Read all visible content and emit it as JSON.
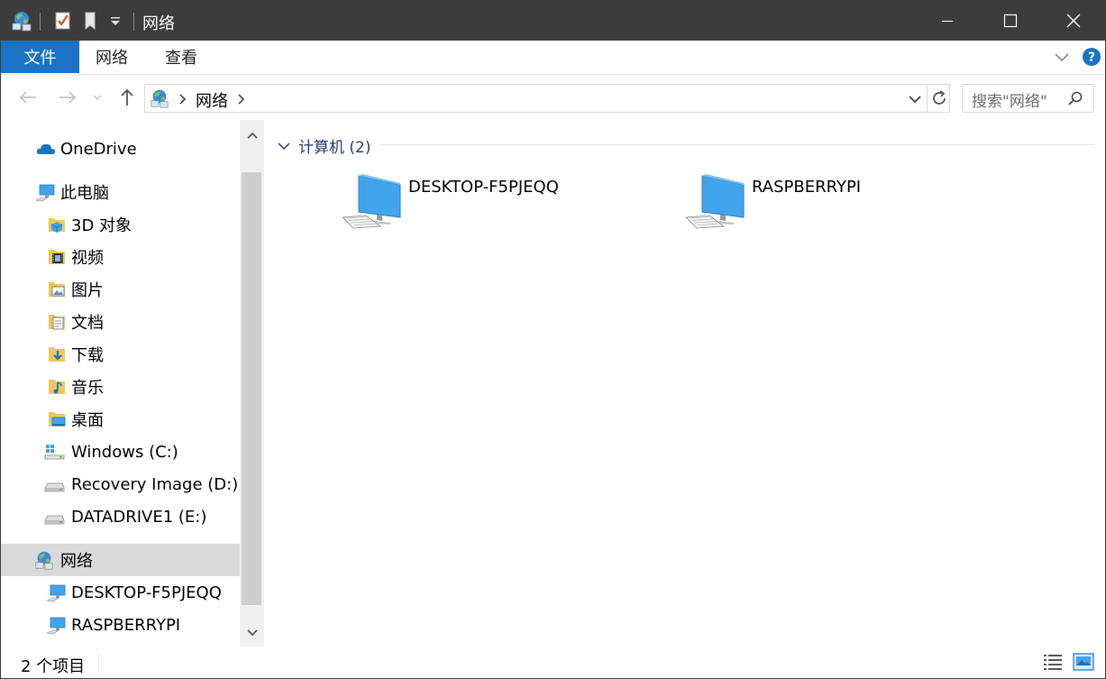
{
  "window": {
    "title": "网络",
    "minimize_icon": "minimize-icon",
    "maximize_icon": "maximize-icon",
    "close_icon": "close-icon"
  },
  "ribbon": {
    "tabs": [
      {
        "label": "文件",
        "active": true
      },
      {
        "label": "网络",
        "active": false
      },
      {
        "label": "查看",
        "active": false
      }
    ]
  },
  "address_bar": {
    "location": "网络",
    "search_placeholder": "搜索\"网络\""
  },
  "sidebar": {
    "items": [
      {
        "label": "OneDrive",
        "icon": "cloud-icon"
      },
      {
        "label": "此电脑",
        "icon": "computer-icon"
      },
      {
        "label": "3D 对象",
        "icon": "3d-objects-icon"
      },
      {
        "label": "视频",
        "icon": "videos-icon"
      },
      {
        "label": "图片",
        "icon": "pictures-icon"
      },
      {
        "label": "文档",
        "icon": "documents-icon"
      },
      {
        "label": "下载",
        "icon": "downloads-icon"
      },
      {
        "label": "音乐",
        "icon": "music-icon"
      },
      {
        "label": "桌面",
        "icon": "desktop-icon"
      },
      {
        "label": "Windows (C:)",
        "icon": "windows-drive-icon"
      },
      {
        "label": "Recovery Image (D:)",
        "icon": "drive-icon"
      },
      {
        "label": "DATADRIVE1 (E:)",
        "icon": "drive-icon"
      },
      {
        "label": "网络",
        "icon": "network-icon",
        "selected": true
      },
      {
        "label": "DESKTOP-F5PJEQQ",
        "icon": "computer-icon"
      },
      {
        "label": "RASPBERRYPI",
        "icon": "computer-icon"
      }
    ]
  },
  "content": {
    "group_label": "计算机 (2)",
    "computers": [
      {
        "label": "DESKTOP-F5PJEQQ"
      },
      {
        "label": "RASPBERRYPI"
      }
    ]
  },
  "status": {
    "item_count": "2 个项目"
  },
  "colors": {
    "titlebar": "#3c3c3c",
    "file_tab": "#1a73c4",
    "selection": "#d9d9d9",
    "group_header": "#1f3b78",
    "monitor": "#41a5ee"
  }
}
